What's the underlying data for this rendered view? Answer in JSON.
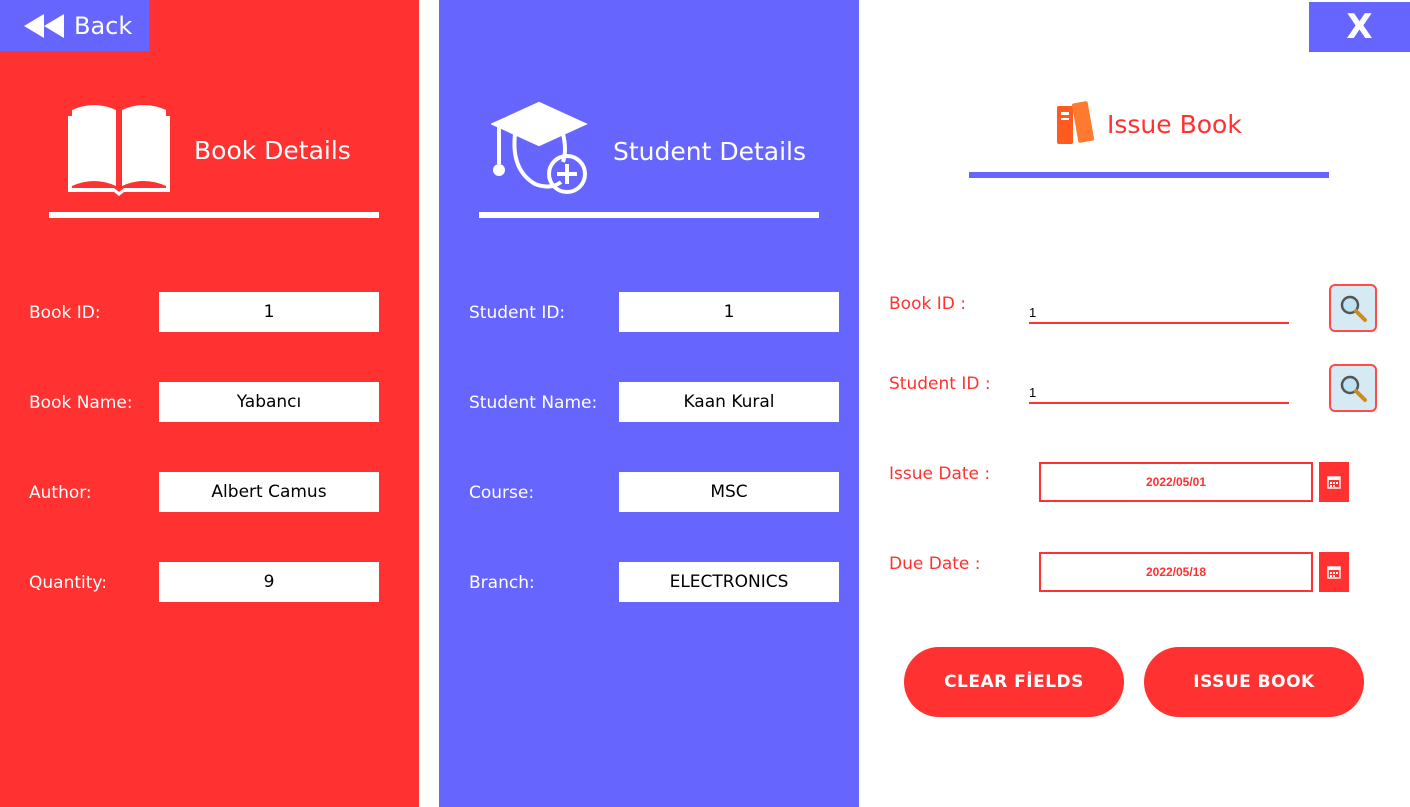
{
  "nav": {
    "back_label": "Back",
    "close_label": "X"
  },
  "book_panel": {
    "title": "Book Details",
    "fields": [
      {
        "label": "Book ID:",
        "value": "1"
      },
      {
        "label": "Book Name:",
        "value": "Yabancı"
      },
      {
        "label": "Author:",
        "value": "Albert Camus"
      },
      {
        "label": "Quantity:",
        "value": "9"
      }
    ]
  },
  "student_panel": {
    "title": "Student Details",
    "fields": [
      {
        "label": "Student ID:",
        "value": "1"
      },
      {
        "label": "Student Name:",
        "value": "Kaan Kural"
      },
      {
        "label": "Course:",
        "value": "MSC"
      },
      {
        "label": "Branch:",
        "value": "ELECTRONICS"
      }
    ]
  },
  "issue_panel": {
    "title": "Issue Book",
    "book_id_label": "Book ID :",
    "book_id_value": "1",
    "student_id_label": "Student ID :",
    "student_id_value": "1",
    "issue_date_label": "Issue Date :",
    "issue_date_value": "2022/05/01",
    "due_date_label": "Due Date :",
    "due_date_value": "2022/05/18",
    "clear_button": "CLEAR FİELDS",
    "issue_button": "ISSUE BOOK"
  },
  "colors": {
    "red": "#ff3131",
    "blue": "#6666ff",
    "white": "#ffffff"
  }
}
